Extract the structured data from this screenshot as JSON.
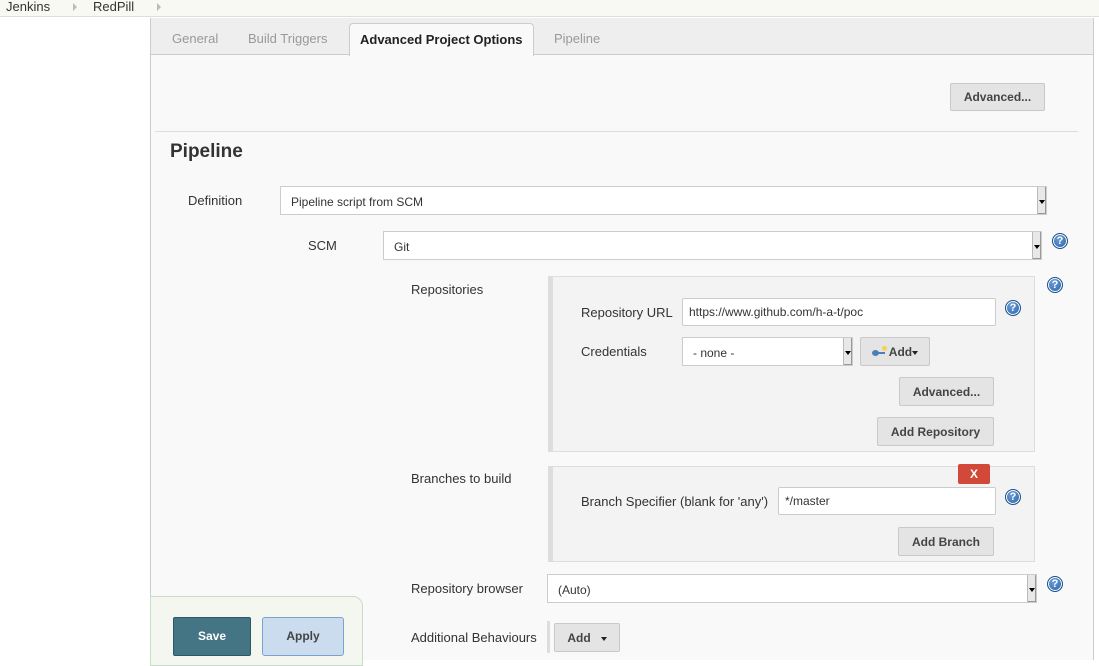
{
  "breadcrumb": {
    "items": [
      "Jenkins",
      "RedPill"
    ]
  },
  "tabs": [
    {
      "label": "General",
      "active": false
    },
    {
      "label": "Build Triggers",
      "active": false
    },
    {
      "label": "Advanced Project Options",
      "active": true
    },
    {
      "label": "Pipeline",
      "active": false
    }
  ],
  "advanced_options": {
    "advanced_button": "Advanced..."
  },
  "pipeline": {
    "title": "Pipeline",
    "definition": {
      "label": "Definition",
      "value": "Pipeline script from SCM"
    },
    "scm": {
      "label": "SCM",
      "value": "Git"
    },
    "repositories": {
      "label": "Repositories",
      "url_label": "Repository URL",
      "url_value": "https://www.github.com/h-a-t/poc",
      "credentials_label": "Credentials",
      "credentials_value": "- none -",
      "add_credentials_button": "Add",
      "advanced_button": "Advanced...",
      "add_repository_button": "Add Repository"
    },
    "branches": {
      "label": "Branches to build",
      "delete_button": "X",
      "specifier_label": "Branch Specifier (blank for 'any')",
      "specifier_value": "*/master",
      "add_branch_button": "Add Branch"
    },
    "repository_browser": {
      "label": "Repository browser",
      "value": "(Auto)"
    },
    "additional_behaviours": {
      "label": "Additional Behaviours",
      "add_button": "Add"
    }
  },
  "footer": {
    "save_button": "Save",
    "apply_button": "Apply"
  },
  "icons": {
    "help": "?"
  }
}
